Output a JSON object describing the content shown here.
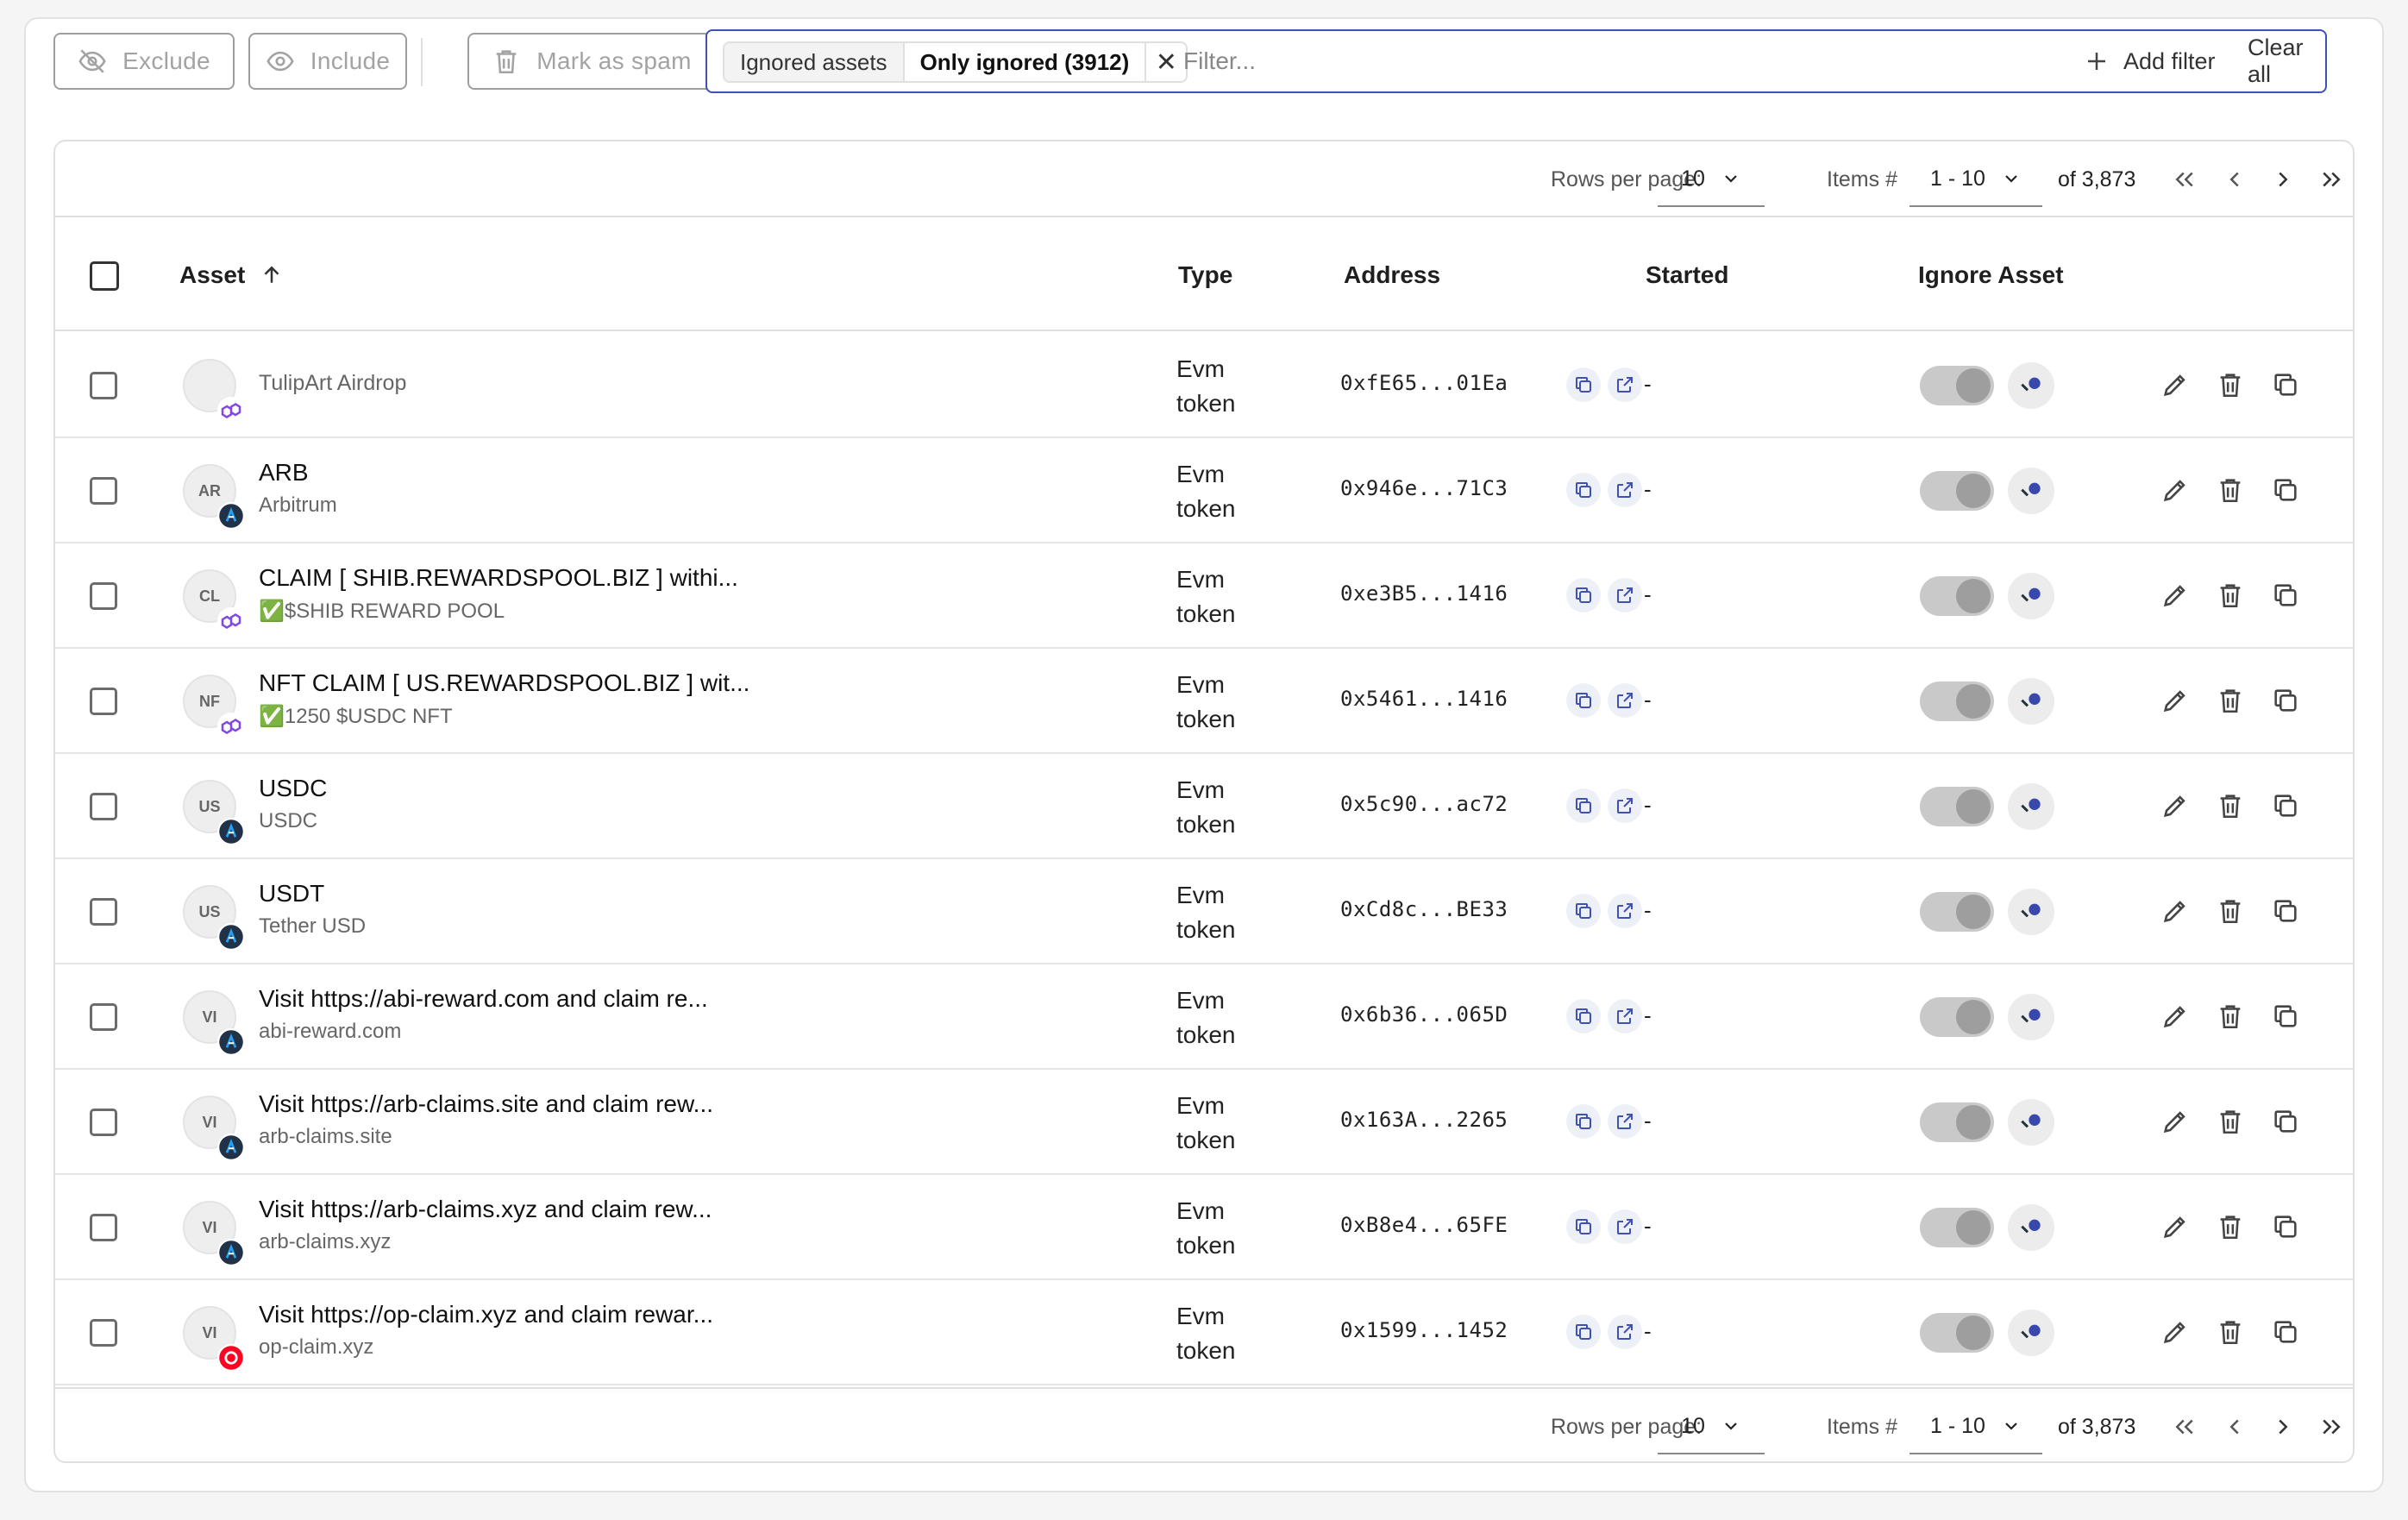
{
  "toolbar": {
    "exclude_label": "Exclude",
    "include_label": "Include",
    "spam_label": "Mark as spam"
  },
  "filter": {
    "chip_key": "Ignored assets",
    "chip_value": "Only ignored (3912)",
    "placeholder": "Filter...",
    "add_filter_label": "Add filter",
    "clear_all_label": "Clear all"
  },
  "pagination": {
    "rows_per_page_label": "Rows per page:",
    "rows_per_page": "10",
    "items_label": "Items #",
    "items_range": "1 - 10",
    "total": "of 3,873"
  },
  "columns": {
    "asset": "Asset",
    "type": "Type",
    "address": "Address",
    "started": "Started",
    "ignore": "Ignore Asset"
  },
  "rows": [
    {
      "symbol": "",
      "name": "TulipArt Airdrop",
      "sub": "",
      "chain": "polygon",
      "type1": "Evm",
      "type2": "token",
      "address": "0xfE65...01Ea",
      "started": "-"
    },
    {
      "symbol": "AR",
      "name": "ARB",
      "sub": "Arbitrum",
      "chain": "arbitrum",
      "type1": "Evm",
      "type2": "token",
      "address": "0x946e...71C3",
      "started": "-"
    },
    {
      "symbol": "CL",
      "name": "CLAIM [ SHIB.REWARDSPOOL.BIZ ] withi...",
      "sub": "✅$SHIB REWARD POOL",
      "chain": "polygon",
      "type1": "Evm",
      "type2": "token",
      "address": "0xe3B5...1416",
      "started": "-"
    },
    {
      "symbol": "NF",
      "name": "NFT CLAIM [ US.REWARDSPOOL.BIZ ] wit...",
      "sub": "✅1250 $USDC NFT",
      "chain": "polygon",
      "type1": "Evm",
      "type2": "token",
      "address": "0x5461...1416",
      "started": "-"
    },
    {
      "symbol": "US",
      "name": "USDC",
      "sub": "USDC",
      "chain": "arbitrum",
      "type1": "Evm",
      "type2": "token",
      "address": "0x5c90...ac72",
      "started": "-"
    },
    {
      "symbol": "US",
      "name": "USDT",
      "sub": "Tether USD",
      "chain": "arbitrum",
      "type1": "Evm",
      "type2": "token",
      "address": "0xCd8c...BE33",
      "started": "-"
    },
    {
      "symbol": "VI",
      "name": "Visit https://abi-reward.com and claim re...",
      "sub": "abi-reward.com",
      "chain": "arbitrum",
      "type1": "Evm",
      "type2": "token",
      "address": "0x6b36...065D",
      "started": "-"
    },
    {
      "symbol": "VI",
      "name": "Visit https://arb-claims.site and claim rew...",
      "sub": "arb-claims.site",
      "chain": "arbitrum",
      "type1": "Evm",
      "type2": "token",
      "address": "0x163A...2265",
      "started": "-"
    },
    {
      "symbol": "VI",
      "name": "Visit https://arb-claims.xyz and claim rew...",
      "sub": "arb-claims.xyz",
      "chain": "arbitrum",
      "type1": "Evm",
      "type2": "token",
      "address": "0xB8e4...65FE",
      "started": "-"
    },
    {
      "symbol": "VI",
      "name": "Visit https://op-claim.xyz and claim rewar...",
      "sub": "op-claim.xyz",
      "chain": "optimism",
      "type1": "Evm",
      "type2": "token",
      "address": "0x1599...1452",
      "started": "-"
    }
  ]
}
